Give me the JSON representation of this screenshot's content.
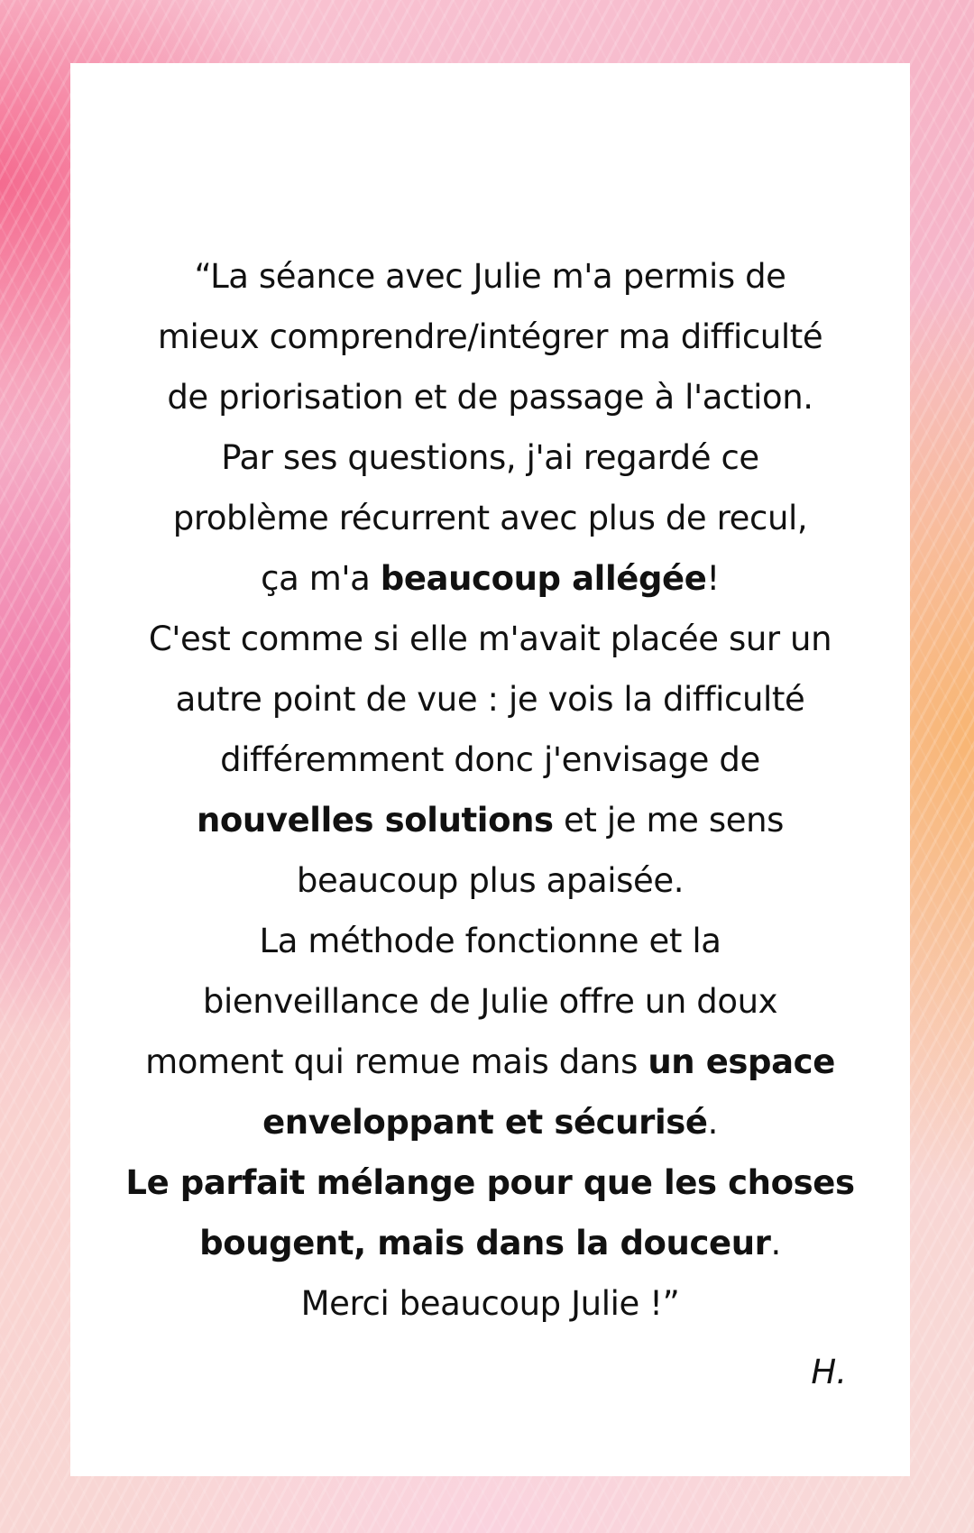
{
  "testimonial": {
    "lines": [
      [
        {
          "text": "“La séance avec Julie m'a permis de",
          "bold": false
        }
      ],
      [
        {
          "text": "mieux comprendre/intégrer ma difficulté",
          "bold": false
        }
      ],
      [
        {
          "text": "de priorisation et de passage à l'action.",
          "bold": false
        }
      ],
      [
        {
          "text": "Par ses questions, j'ai regardé ce",
          "bold": false
        }
      ],
      [
        {
          "text": "problème récurrent avec plus de recul,",
          "bold": false
        }
      ],
      [
        {
          "text": "ça m'a ",
          "bold": false
        },
        {
          "text": "beaucoup allégée",
          "bold": true
        },
        {
          "text": "!",
          "bold": false
        }
      ],
      [
        {
          "text": "C'est comme si elle m'avait placée sur un",
          "bold": false
        }
      ],
      [
        {
          "text": "autre point de vue : je vois la difficulté",
          "bold": false
        }
      ],
      [
        {
          "text": "différemment donc j'envisage de",
          "bold": false
        }
      ],
      [
        {
          "text": "nouvelles solutions",
          "bold": true
        },
        {
          "text": " et je me sens",
          "bold": false
        }
      ],
      [
        {
          "text": "beaucoup plus apaisée.",
          "bold": false
        }
      ],
      [
        {
          "text": "La méthode fonctionne et la",
          "bold": false
        }
      ],
      [
        {
          "text": "bienveillance de Julie offre un doux",
          "bold": false
        }
      ],
      [
        {
          "text": "moment qui remue mais dans ",
          "bold": false
        },
        {
          "text": "un espace",
          "bold": true
        }
      ],
      [
        {
          "text": "enveloppant et sécurisé",
          "bold": true
        },
        {
          "text": ".",
          "bold": false
        }
      ],
      [
        {
          "text": "Le parfait mélange pour que les choses",
          "bold": true
        }
      ],
      [
        {
          "text": "bougent, mais dans la douceur",
          "bold": true
        },
        {
          "text": ".",
          "bold": false
        }
      ],
      [
        {
          "text": "Merci beaucoup Julie !”",
          "bold": false
        }
      ]
    ],
    "signature": "H."
  },
  "colors": {
    "card_background": "#ffffff",
    "text": "#111111",
    "background_pink": "#f45c84",
    "background_peach": "#f8b268"
  }
}
